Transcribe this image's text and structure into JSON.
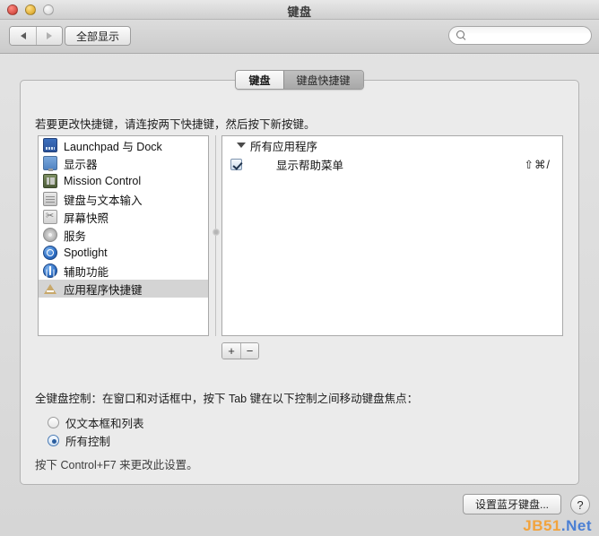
{
  "window": {
    "title": "键盘",
    "traffic_lights": [
      "close",
      "minimize",
      "zoom"
    ]
  },
  "toolbar": {
    "back_icon": "triangle-left-icon",
    "forward_icon": "triangle-right-icon",
    "show_all_label": "全部显示",
    "search": {
      "icon": "search-icon",
      "value": "",
      "placeholder": ""
    }
  },
  "tabs": [
    {
      "label": "键盘",
      "active": true
    },
    {
      "label": "键盘快捷键",
      "active": false
    }
  ],
  "panel": {
    "hint": "若要更改快捷键，请连按两下快捷键，然后按下新按键。",
    "sidebar": {
      "items": [
        {
          "label": "Launchpad 与 Dock",
          "icon": "launchpad-icon",
          "selected": false
        },
        {
          "label": "显示器",
          "icon": "display-icon",
          "selected": false
        },
        {
          "label": "Mission Control",
          "icon": "mission-control-icon",
          "selected": false
        },
        {
          "label": "键盘与文本输入",
          "icon": "keyboard-icon",
          "selected": false
        },
        {
          "label": "屏幕快照",
          "icon": "screenshot-icon",
          "selected": false
        },
        {
          "label": "服务",
          "icon": "services-icon",
          "selected": false
        },
        {
          "label": "Spotlight",
          "icon": "spotlight-icon",
          "selected": false
        },
        {
          "label": "辅助功能",
          "icon": "accessibility-icon",
          "selected": false
        },
        {
          "label": "应用程序快捷键",
          "icon": "app-shortcuts-icon",
          "selected": true
        }
      ]
    },
    "shortcut_list": {
      "group_label": "所有应用程序",
      "rows": [
        {
          "name": "显示帮助菜单",
          "keys": "⇧⌘/",
          "checked": true
        }
      ]
    },
    "add_button_label": "+",
    "remove_button_label": "−",
    "full_keyboard_access": {
      "label": "全键盘控制：在窗口和对话框中，按下 Tab 键在以下控制之间移动键盘焦点：",
      "options": [
        {
          "label": "仅文本框和列表",
          "selected": false
        },
        {
          "label": "所有控制",
          "selected": true
        }
      ],
      "note": "按下 Control+F7 来更改此设置。"
    }
  },
  "footer": {
    "bluetooth_button_label": "设置蓝牙键盘...",
    "help_button_label": "?",
    "watermark": {
      "part1": "JB51",
      "part2": ".Net"
    }
  },
  "colors": {
    "accent": "#2a5d9e",
    "selection": "#d4d4d4",
    "watermark_orange": "#f2a33c",
    "watermark_blue": "#4a7fd4"
  }
}
